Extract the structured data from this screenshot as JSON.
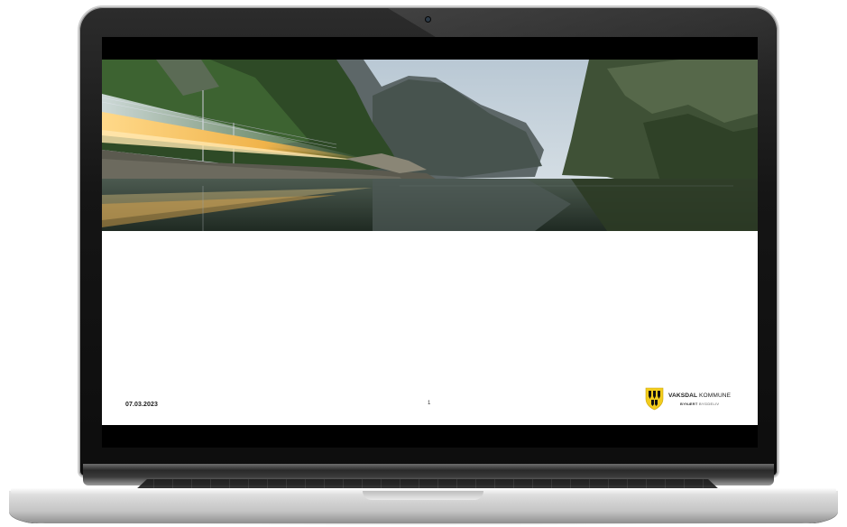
{
  "slide": {
    "date": "07.03.2023",
    "page_number": "1",
    "banner_image": "fjord-railway-light-trails-photo"
  },
  "brand": {
    "name_bold": "VAKSDAL",
    "name_regular": " KOMMUNE",
    "tagline_bold": "BYNÆRT",
    "tagline_regular": " BYGDELIV",
    "shield_colors": [
      "#f2cc1c",
      "#111111"
    ]
  },
  "device": {
    "type": "laptop"
  }
}
